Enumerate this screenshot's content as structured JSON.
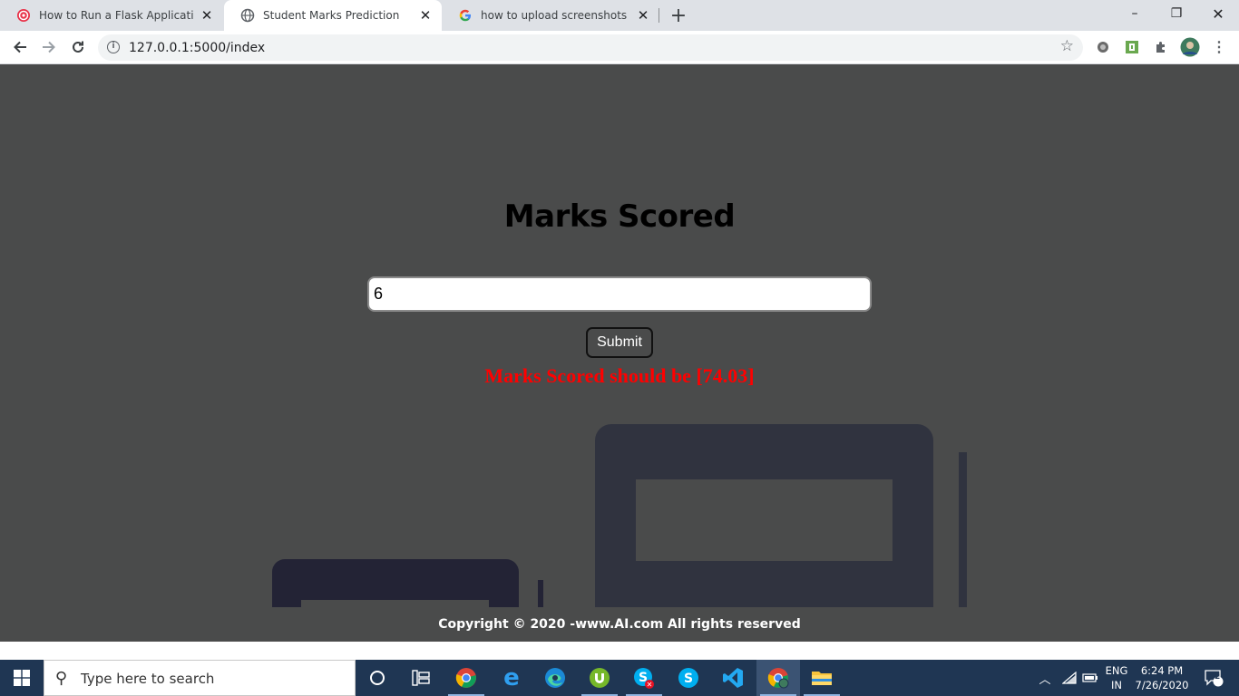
{
  "browser": {
    "tabs": [
      {
        "title": "How to Run a Flask Application -",
        "favicon": "flask-site-icon",
        "active": false
      },
      {
        "title": "Student Marks Prediction",
        "favicon": "globe-icon",
        "active": true
      },
      {
        "title": "how to upload screenshots on st",
        "favicon": "google-icon",
        "active": false
      }
    ],
    "new_tab": "+",
    "window_controls": {
      "minimize": "–",
      "restore": "❐",
      "close": "✕"
    },
    "url": "127.0.0.1:5000/index"
  },
  "page": {
    "title": "Marks Scored",
    "input_value": "6",
    "submit_label": "Submit",
    "result_text": "Marks Scored should be [74.03]",
    "footer_text": "Copyright © 2020 -www.AI.com All rights reserved",
    "colors": {
      "background": "#4a4b4b",
      "result": "#ff0000"
    }
  },
  "taskbar": {
    "search_placeholder": "Type here to search",
    "apps": [
      "cortana-icon",
      "task-view-icon",
      "chrome-icon",
      "edge-legacy-icon",
      "edge-icon",
      "utorrent-icon",
      "skype-error-icon",
      "skype-icon",
      "vscode-icon",
      "chrome-profile-icon",
      "file-explorer-icon"
    ],
    "language_line1": "ENG",
    "language_line2": "IN",
    "time": "6:24 PM",
    "date": "7/26/2020",
    "notification_count": "2"
  }
}
